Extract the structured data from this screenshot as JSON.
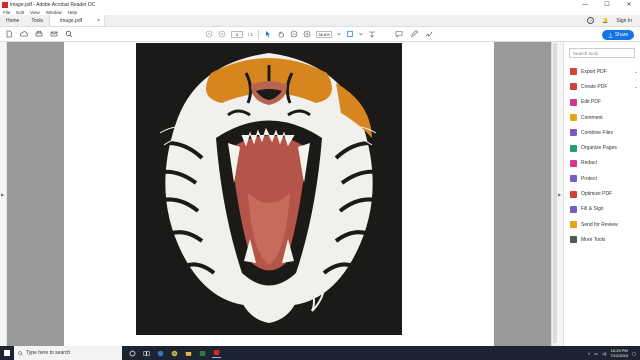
{
  "window": {
    "title": "image.pdf - Adobe Acrobat Reader DC",
    "minimize": "—",
    "maximize": "☐",
    "close": "✕"
  },
  "menu": [
    "File",
    "Edit",
    "View",
    "Window",
    "Help"
  ],
  "tabs": {
    "home": "Home",
    "tools": "Tools",
    "doc": "image.pdf",
    "doc_close": "×",
    "sign_in": "Sign In",
    "help_icon": "?",
    "bell_icon": "🔔"
  },
  "toolbar": {
    "page_current": "1",
    "page_total": "/ 1",
    "zoom": "36.6%",
    "share_label": "Share"
  },
  "search": {
    "placeholder": "Search tools"
  },
  "tools": [
    {
      "label": "Export PDF",
      "color": "#d04437",
      "expandable": true
    },
    {
      "label": "Create PDF",
      "color": "#d04437",
      "expandable": true
    },
    {
      "label": "Edit PDF",
      "color": "#d83790",
      "expandable": false
    },
    {
      "label": "Comment",
      "color": "#e8a317",
      "expandable": false
    },
    {
      "label": "Combine Files",
      "color": "#7a5cc4",
      "expandable": false
    },
    {
      "label": "Organize Pages",
      "color": "#2d9d78",
      "expandable": false
    },
    {
      "label": "Redact",
      "color": "#d83790",
      "expandable": false
    },
    {
      "label": "Protect",
      "color": "#7a5cc4",
      "expandable": false
    },
    {
      "label": "Optimize PDF",
      "color": "#d04437",
      "expandable": false
    },
    {
      "label": "Fill & Sign",
      "color": "#7a5cc4",
      "expandable": false
    },
    {
      "label": "Send for Review",
      "color": "#e8a317",
      "expandable": false
    },
    {
      "label": "More Tools",
      "color": "#555555",
      "expandable": false
    }
  ],
  "taskbar": {
    "search_placeholder": "Type here to search",
    "time": "10:29 PM",
    "date": "7/12/2019"
  }
}
